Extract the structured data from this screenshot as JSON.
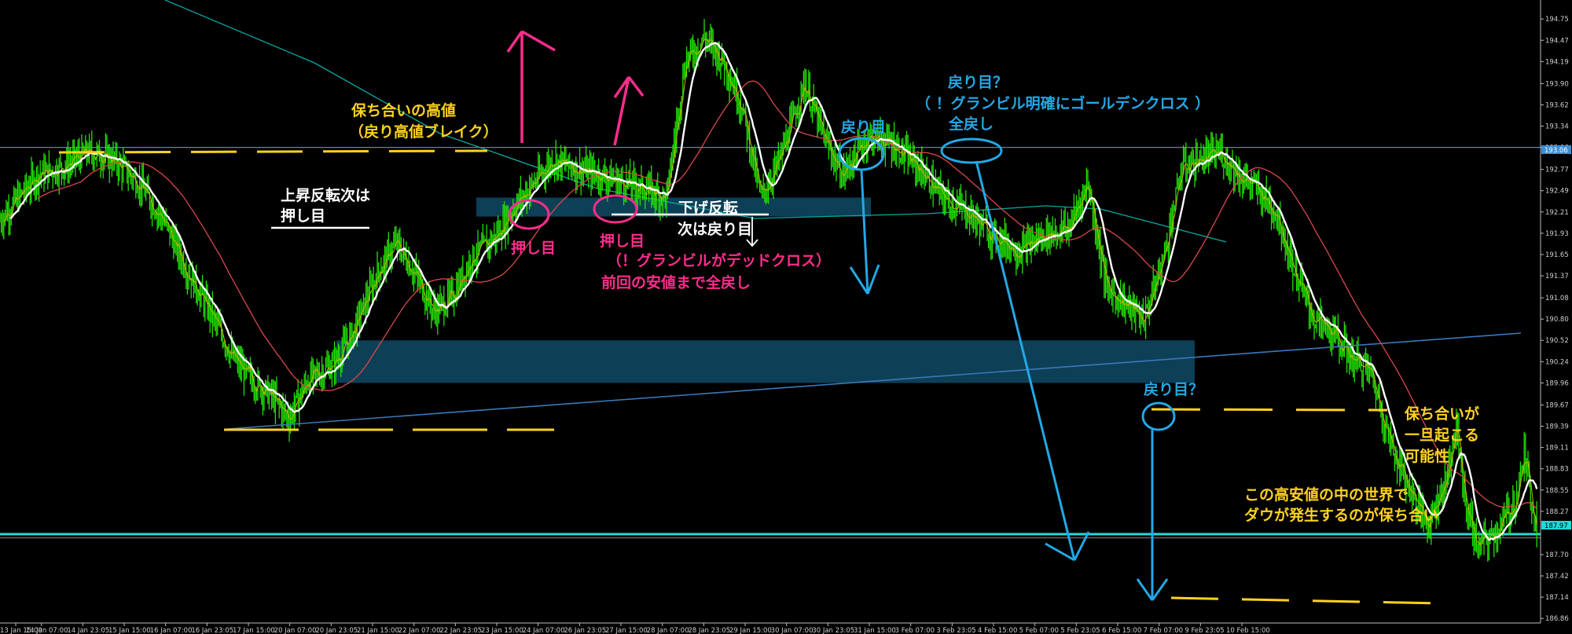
{
  "chart_data": {
    "type": "line",
    "subtype": "candlestick",
    "grid": false,
    "background": "#000000",
    "colors": {
      "candle": "#22e000",
      "ma_fast": "#c8b400",
      "ma_mid": "#ffffff",
      "ma_slow": "#d94848",
      "ma_long": "#0aa7a0",
      "zone": "#0d3f57",
      "trendline": "#3c78b8",
      "level_line": "#3a8fd6",
      "support_line": "#22d8d8",
      "yellow_text": "#ffd21e",
      "pink": "#ff2c8c",
      "blue": "#23a8e6",
      "white": "#ffffff"
    },
    "ylim": [
      186.8,
      195.0
    ],
    "y_ticks": [
      186.86,
      187.14,
      187.42,
      187.7,
      188.27,
      188.55,
      188.83,
      189.11,
      189.39,
      189.67,
      189.96,
      190.24,
      190.52,
      190.8,
      191.08,
      191.37,
      191.65,
      191.93,
      192.21,
      192.49,
      192.77,
      193.06,
      193.34,
      193.62,
      193.9,
      194.19,
      194.47,
      194.75
    ],
    "current_price_labels": [
      "193.06",
      "187.97"
    ],
    "x_ticks": [
      "13 Jan 15:00",
      "14 Jan 07:00",
      "14 Jan 23:05",
      "15 Jan 15:00",
      "16 Jan 07:00",
      "16 Jan 23:05",
      "17 Jan 15:00",
      "20 Jan 07:00",
      "20 Jan 23:05",
      "21 Jan 15:00",
      "22 Jan 07:00",
      "22 Jan 23:05",
      "23 Jan 15:00",
      "24 Jan 07:00",
      "26 Jan 23:05",
      "27 Jan 15:00",
      "28 Jan 07:00",
      "28 Jan 23:05",
      "29 Jan 15:00",
      "30 Jan 07:00",
      "30 Jan 23:05",
      "31 Jan 15:00",
      "3 Feb 07:00",
      "3 Feb 23:05",
      "4 Feb 15:00",
      "5 Feb 07:00",
      "5 Feb 23:05",
      "6 Feb 15:00",
      "7 Feb 07:00",
      "9 Feb 23:05",
      "10 Feb 15:00"
    ],
    "price_path": [
      [
        0,
        192.1
      ],
      [
        15,
        192.4
      ],
      [
        30,
        192.7
      ],
      [
        50,
        192.8
      ],
      [
        70,
        193.0
      ],
      [
        90,
        192.9
      ],
      [
        110,
        192.6
      ],
      [
        130,
        192.1
      ],
      [
        150,
        191.4
      ],
      [
        170,
        190.8
      ],
      [
        185,
        190.3
      ],
      [
        200,
        190.0
      ],
      [
        215,
        189.8
      ],
      [
        230,
        189.5
      ],
      [
        245,
        190.0
      ],
      [
        265,
        190.2
      ],
      [
        280,
        190.6
      ],
      [
        300,
        191.4
      ],
      [
        315,
        191.8
      ],
      [
        330,
        191.4
      ],
      [
        345,
        190.9
      ],
      [
        360,
        191.1
      ],
      [
        375,
        191.6
      ],
      [
        395,
        191.9
      ],
      [
        410,
        192.3
      ],
      [
        425,
        192.6
      ],
      [
        440,
        192.9
      ],
      [
        455,
        192.8
      ],
      [
        475,
        192.7
      ],
      [
        495,
        192.6
      ],
      [
        515,
        192.5
      ],
      [
        530,
        192.4
      ],
      [
        545,
        194.2
      ],
      [
        560,
        194.5
      ],
      [
        575,
        194.2
      ],
      [
        590,
        193.6
      ],
      [
        605,
        192.4
      ],
      [
        620,
        192.9
      ],
      [
        640,
        193.9
      ],
      [
        655,
        193.2
      ],
      [
        670,
        192.7
      ],
      [
        690,
        193.2
      ],
      [
        710,
        193.1
      ],
      [
        730,
        192.8
      ],
      [
        750,
        192.4
      ],
      [
        770,
        192.2
      ],
      [
        790,
        191.9
      ],
      [
        810,
        191.7
      ],
      [
        830,
        191.9
      ],
      [
        850,
        192.0
      ],
      [
        865,
        192.6
      ],
      [
        880,
        191.2
      ],
      [
        895,
        191.0
      ],
      [
        910,
        190.8
      ],
      [
        925,
        191.6
      ],
      [
        940,
        192.8
      ],
      [
        955,
        192.9
      ],
      [
        970,
        193.0
      ],
      [
        985,
        192.7
      ],
      [
        1000,
        192.5
      ],
      [
        1015,
        192.2
      ],
      [
        1030,
        191.4
      ],
      [
        1045,
        190.8
      ],
      [
        1060,
        190.6
      ],
      [
        1075,
        190.3
      ],
      [
        1090,
        190.1
      ],
      [
        1105,
        189.2
      ],
      [
        1120,
        188.6
      ],
      [
        1135,
        188.1
      ],
      [
        1150,
        188.7
      ],
      [
        1158,
        189.4
      ],
      [
        1165,
        188.4
      ],
      [
        1175,
        187.8
      ],
      [
        1190,
        188.0
      ],
      [
        1205,
        188.4
      ],
      [
        1212,
        189.0
      ],
      [
        1222,
        188.0
      ]
    ],
    "zones": [
      {
        "from": 606,
        "to": 1108,
        "high": 192.4,
        "low": 192.15
      },
      {
        "from": 428,
        "to": 1520,
        "high": 190.52,
        "low": 189.96
      }
    ],
    "horizontal_levels": [
      193.06,
      187.97
    ],
    "annotations": {
      "yellow_1": "保ち合いの高値",
      "yellow_2": "（戻り高値ブレイク）",
      "white_1": "上昇反転次は",
      "white_2": "押し目",
      "pink_1": "押し目",
      "pink_2": "押し目",
      "pink_3": "（！グランビルがデッドクロス）",
      "pink_4": "前回の安値まで全戻し",
      "white_3": "下げ反転",
      "white_4": "次は戻り目",
      "blue_1": "戻り目",
      "blue_2": "戻り目？",
      "blue_3": "（ ！グランビル明確にゴールデンクロス ）",
      "blue_4": "全戻し",
      "blue_5": "戻り目？",
      "yellow_3": "保ち合いが",
      "yellow_4": "一旦起こる",
      "yellow_5": "可能性",
      "yellow_6": "この高安値の中の世界で",
      "yellow_7": "ダウが発生するのが保ち合い"
    }
  }
}
